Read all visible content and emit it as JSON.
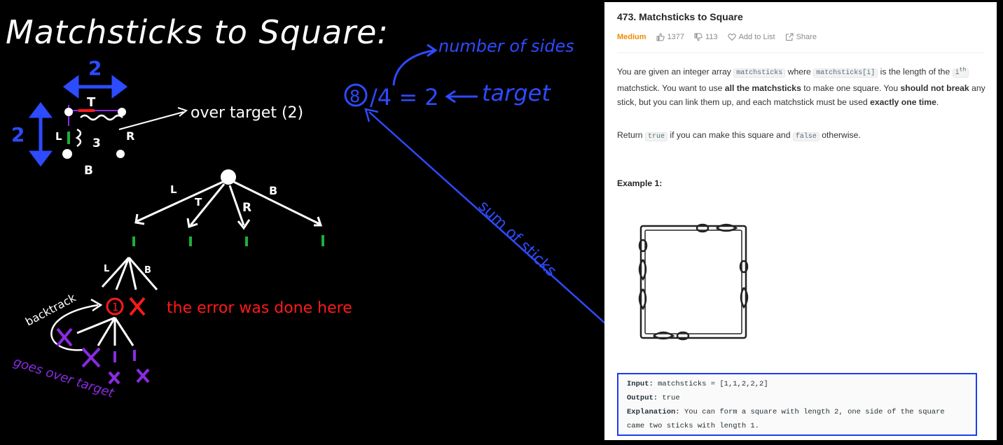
{
  "board": {
    "title": "Matchsticks to Square:",
    "number_of_sides": "number of sides",
    "equation_left": "8",
    "equation_mid": "/4 = 2",
    "target": "target",
    "sum_of_sticks": "sum of sticks",
    "over_target": "over target (2)",
    "dim_top": "2",
    "dim_left": "2",
    "sq_T": "T",
    "sq_L": "L",
    "sq_R": "R",
    "sq_B": "B",
    "sq_3": "3",
    "tree_L": "L",
    "tree_T": "T",
    "tree_R": "R",
    "tree_B": "B",
    "sub_L": "L",
    "sub_B": "B",
    "node_one": "1",
    "backtrack": "backtrack",
    "error_note": "the error was done here",
    "goes_over_target": "goes over target",
    "colors": {
      "blue": "#2d4bff",
      "red": "#ff1a1a",
      "purple": "#8a2be2",
      "green": "#1fae3a",
      "white": "#ffffff"
    }
  },
  "problem": {
    "title": "473. Matchsticks to Square",
    "difficulty": "Medium",
    "likes": "1377",
    "dislikes": "113",
    "add_to_list": "Add to List",
    "share": "Share",
    "desc_1": "You are given an integer array",
    "code_1": "matchsticks",
    "desc_2": "where",
    "code_2": "matchsticks[i]",
    "desc_3": "is the length of the",
    "code_3": "i",
    "sup": "th",
    "desc_4": "matchstick. You want to use",
    "bold_1": "all the matchsticks",
    "desc_5": "to make one square. You",
    "bold_2": "should not break",
    "desc_6": "any stick, but you can link them up, and each matchstick must be used",
    "bold_3": "exactly one time",
    "desc_7": ".",
    "return_1": "Return",
    "code_true": "true",
    "return_2": "if you can make this square and",
    "code_false": "false",
    "return_3": "otherwise.",
    "example_title": "Example 1:",
    "input_label": "Input:",
    "input_value": "matchsticks = [1,1,2,2,2]",
    "output_label": "Output:",
    "output_value": "true",
    "explanation_label": "Explanation:",
    "explanation_1": "You can form a square with length 2, one side of the square",
    "explanation_2": "came two sticks with length 1."
  }
}
